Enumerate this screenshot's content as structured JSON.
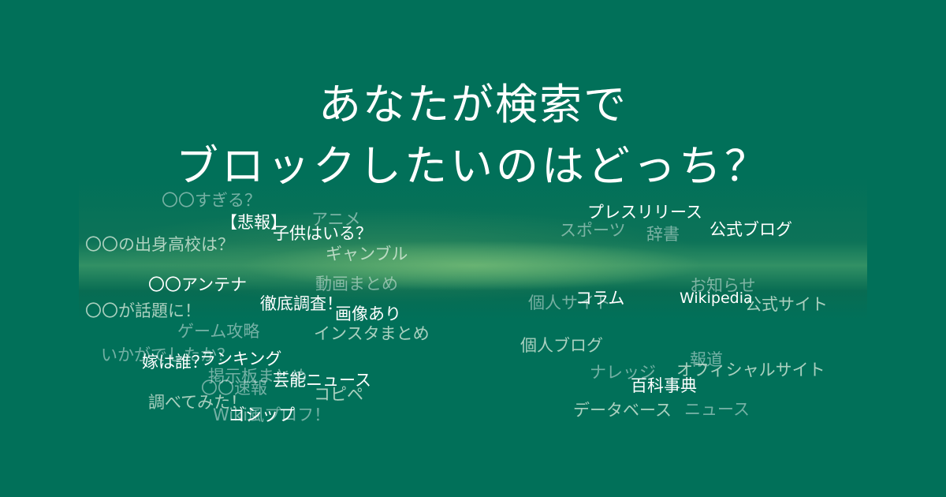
{
  "title": {
    "line1": "あなたが検索で",
    "line2": "ブロックしたいのはどっち？"
  },
  "left_words": [
    "〇〇すぎる？",
    "【悲報】",
    "子供はいる？",
    "アニメ",
    "〇〇の出身高校は？",
    "ギャンブル",
    "〇〇アンテナ",
    "動画まとめ",
    "徹底調査！",
    "〇〇が話題に！",
    "画像あり",
    "ゲーム攻略",
    "インスタまとめ",
    "いかがでしたか？",
    "嫁は誰？",
    "ランキング",
    "芸能ニュース",
    "掲示板まとめ",
    "〇〇速報",
    "コピペ",
    "調べてみた！",
    "Wiki風プロフ！",
    "ゴシップ"
  ],
  "right_words": [
    "プレスリリース",
    "スポーツ",
    "辞書",
    "公式ブログ",
    "コラム",
    "Wikipedia",
    "個人サイト",
    "公式サイト",
    "お知らせ",
    "個人ブログ",
    "報道",
    "ナレッジ",
    "オフィシャルサイト",
    "百科事典",
    "データベース",
    "ニュース"
  ]
}
